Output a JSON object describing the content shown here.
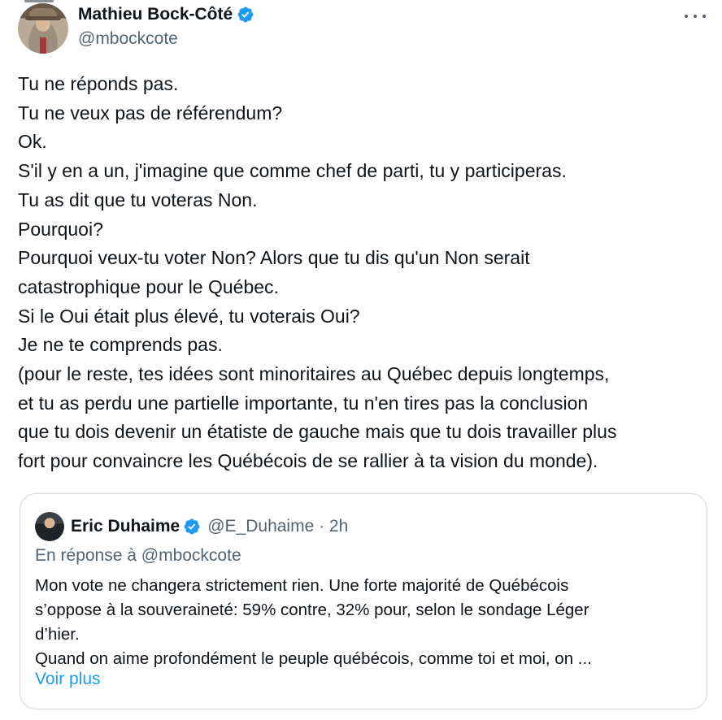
{
  "colors": {
    "text": "#0f1419",
    "secondary": "#536471",
    "link": "#1d9bf0",
    "verified": "#1d9bf0",
    "border": "#cfd9de"
  },
  "author": {
    "name": "Mathieu Bock-Côté",
    "handle": "@mbockcote",
    "avatar_icon": "profile-photo",
    "verified_icon": "verified-badge-icon",
    "more_icon": "more-horizontal-icon"
  },
  "tweet_lines": [
    "Tu ne réponds pas.",
    "Tu ne veux pas de référendum?",
    "Ok.",
    "S'il y en a un, j'imagine que comme chef de parti, tu y participeras.",
    "Tu as dit que tu voteras Non.",
    "Pourquoi?",
    "Pourquoi veux-tu voter Non? Alors que tu dis qu'un Non serait",
    "catastrophique pour le Québec.",
    "Si le Oui était plus élevé, tu voterais Oui?",
    "Je ne te comprends pas.",
    "(pour le reste, tes idées sont minoritaires au Québec depuis longtemps,",
    "et tu as perdu une partielle importante, tu n'en tires pas la conclusion",
    "que tu dois devenir un étatiste de gauche mais que tu dois travailler plus",
    "fort pour convaincre les Québécois de se rallier à ta vision du monde)."
  ],
  "quote": {
    "name": "Eric Duhaime",
    "handle_time": "@E_Duhaime · 2h",
    "reply_to": "En réponse à @mbockcote",
    "lines": [
      "Mon vote ne changera strictement rien. Une forte majorité de Québécois",
      "s’oppose à la souveraineté: 59% contre, 32% pour, selon le sondage Léger",
      "d’hier.",
      "Quand on aime profondément le peuple québécois, comme toi et moi, on ..."
    ],
    "show_more": "Voir plus"
  }
}
